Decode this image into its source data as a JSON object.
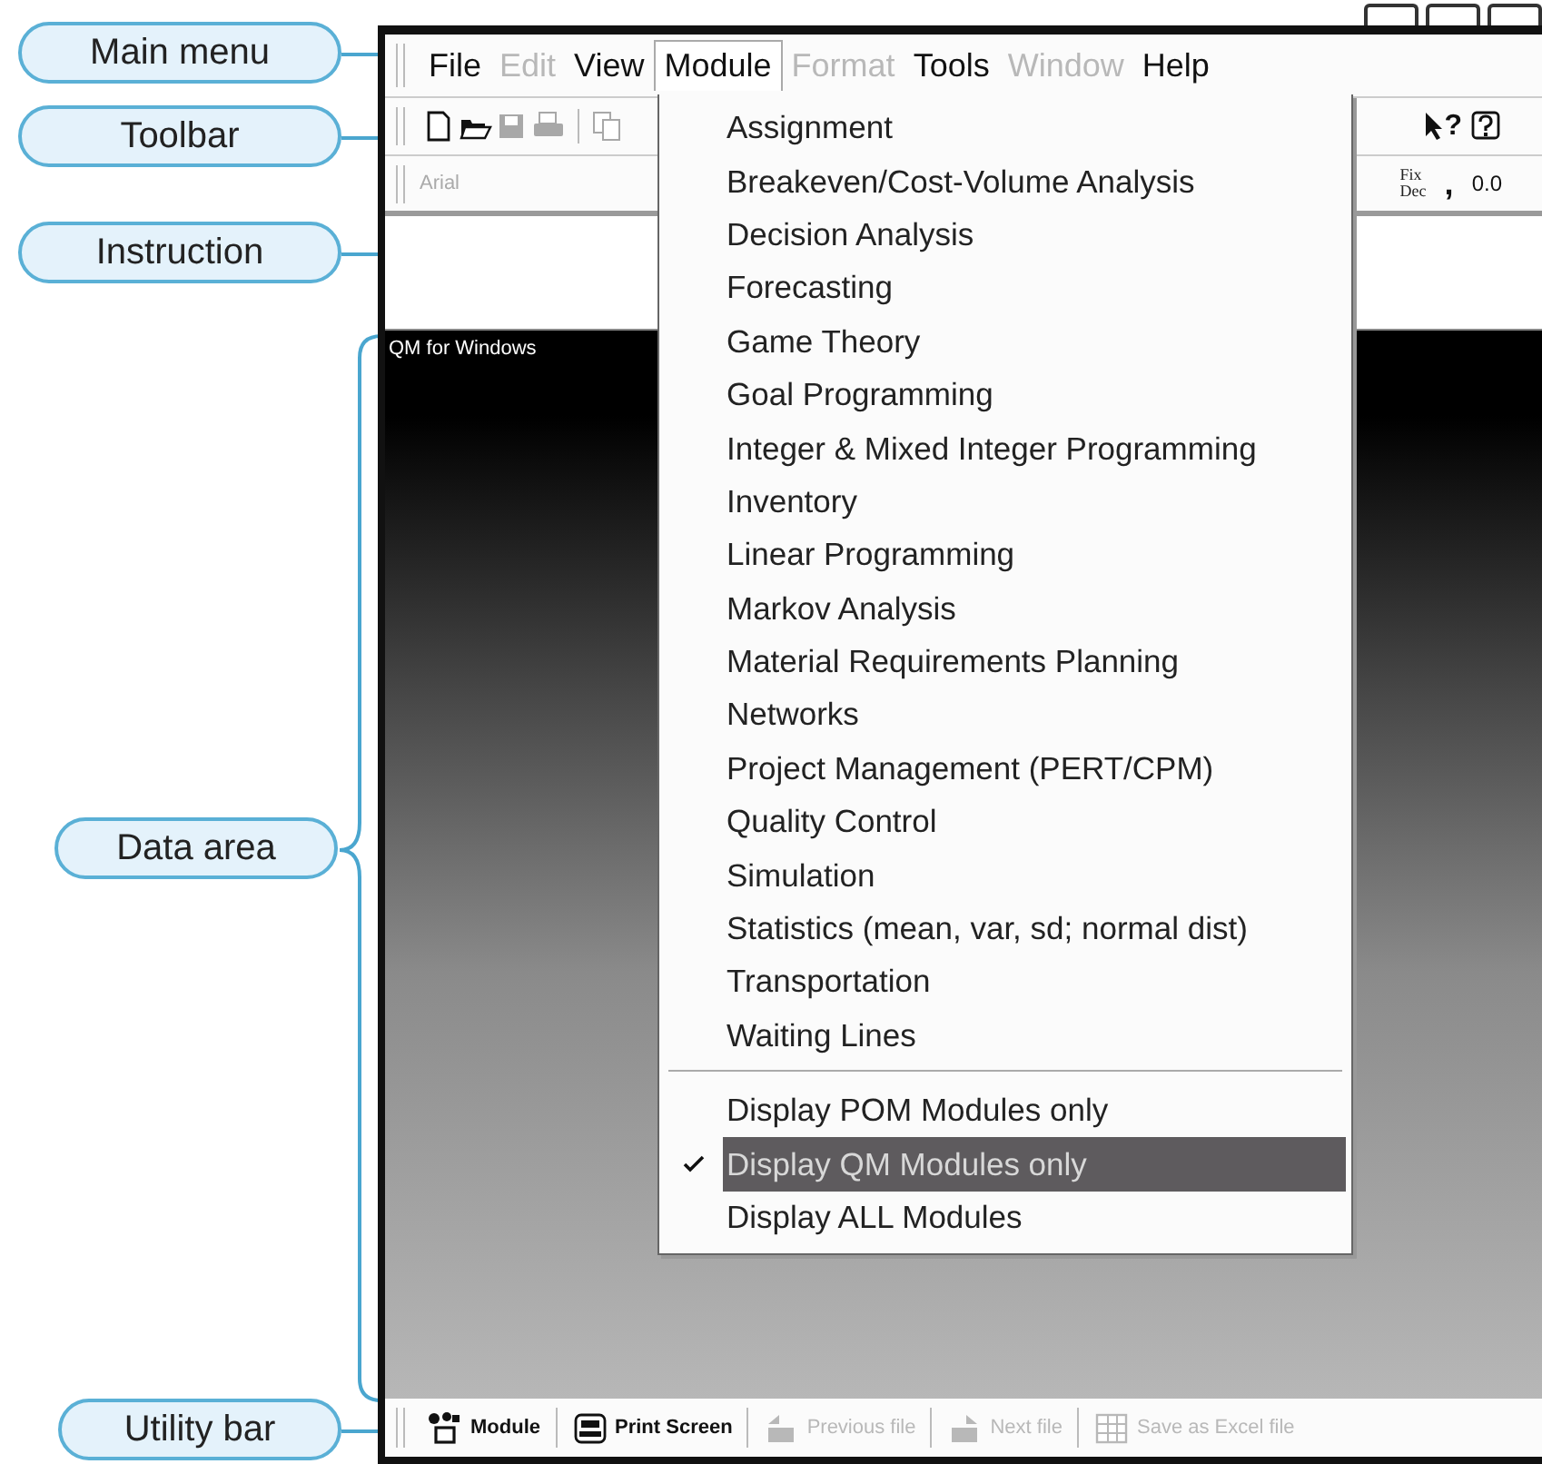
{
  "callouts": [
    {
      "label": "Main menu",
      "kind": "line"
    },
    {
      "label": "Toolbar",
      "kind": "line"
    },
    {
      "label": "Instruction",
      "kind": "line"
    },
    {
      "label": "Data area",
      "kind": "brace"
    },
    {
      "label": "Utility bar",
      "kind": "line"
    }
  ],
  "window": {
    "menu": [
      {
        "label": "File",
        "disabled": false,
        "selected": false
      },
      {
        "label": "Edit",
        "disabled": true,
        "selected": false
      },
      {
        "label": "View",
        "disabled": false,
        "selected": false
      },
      {
        "label": "Module",
        "disabled": false,
        "selected": true
      },
      {
        "label": "Format",
        "disabled": true,
        "selected": false
      },
      {
        "label": "Tools",
        "disabled": false,
        "selected": false
      },
      {
        "label": "Window",
        "disabled": true,
        "selected": false
      },
      {
        "label": "Help",
        "disabled": false,
        "selected": false
      }
    ],
    "toolbar": {
      "left": [
        {
          "kind": "new",
          "disabled": false
        },
        {
          "kind": "open",
          "disabled": false
        },
        {
          "kind": "save",
          "disabled": true
        },
        {
          "kind": "print",
          "disabled": true
        },
        {
          "kind": "copy",
          "disabled": true
        }
      ],
      "right": [
        {
          "kind": "pointer-help",
          "label": "?",
          "disabled": false
        },
        {
          "kind": "help",
          "disabled": false
        }
      ]
    },
    "format_bar": {
      "font": "Arial",
      "fix_label": "Fix",
      "dec_label": "Dec",
      "separator": ",",
      "decimals": "0.0"
    },
    "data_area": {
      "title": "QM for Windows"
    },
    "module_menu": {
      "modules": [
        {
          "label": "Assignment",
          "selected": false
        },
        {
          "label": "Breakeven/Cost-Volume Analysis",
          "selected": false
        },
        {
          "label": "Decision Analysis",
          "selected": false
        },
        {
          "label": "Forecasting",
          "selected": false
        },
        {
          "label": "Game Theory",
          "selected": false
        },
        {
          "label": "Goal Programming",
          "selected": false
        },
        {
          "label": "Integer & Mixed Integer Programming",
          "selected": false
        },
        {
          "label": "Inventory",
          "selected": false
        },
        {
          "label": "Linear Programming",
          "selected": false
        },
        {
          "label": "Markov Analysis",
          "selected": false
        },
        {
          "label": "Material Requirements Planning",
          "selected": false
        },
        {
          "label": "Networks",
          "selected": false
        },
        {
          "label": "Project Management (PERT/CPM)",
          "selected": false
        },
        {
          "label": "Quality Control",
          "selected": false
        },
        {
          "label": "Simulation",
          "selected": false
        },
        {
          "label": "Statistics (mean, var, sd; normal dist)",
          "selected": false
        },
        {
          "label": "Transportation",
          "selected": false
        },
        {
          "label": "Waiting Lines",
          "selected": false
        }
      ],
      "display_options": [
        {
          "label": "Display POM Modules only",
          "checked": false,
          "selected": false
        },
        {
          "label": "Display QM Modules only",
          "checked": true,
          "selected": true
        },
        {
          "label": "Display ALL Modules",
          "checked": false,
          "selected": false
        }
      ]
    },
    "utility_bar": [
      {
        "label": "Module",
        "kind": "module",
        "disabled": false
      },
      {
        "label": "Print Screen",
        "kind": "print",
        "disabled": false
      },
      {
        "label": "Previous file",
        "kind": "previous",
        "disabled": true
      },
      {
        "label": "Next file",
        "kind": "next",
        "disabled": true
      },
      {
        "label": "Save as Excel file",
        "kind": "excel",
        "disabled": true
      }
    ]
  }
}
